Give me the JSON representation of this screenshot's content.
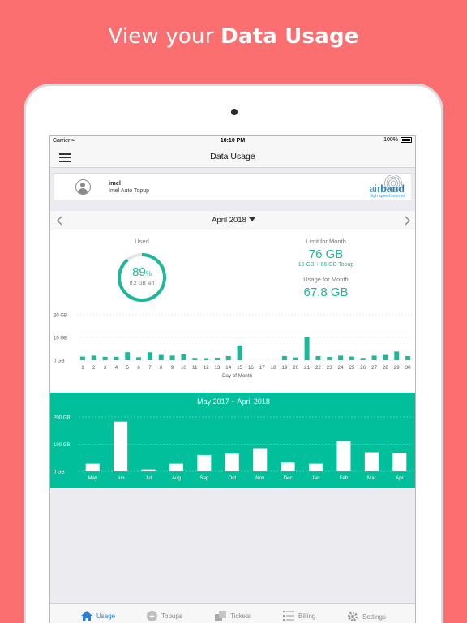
{
  "headline": {
    "prefix": "View your ",
    "bold": "Data Usage"
  },
  "status": {
    "carrier": "Carrier",
    "time": "10:10 PM",
    "battery": "100%"
  },
  "nav": {
    "title": "Data Usage"
  },
  "account": {
    "name": "imel",
    "plan": "Imel Auto Topup",
    "brand_air": "air",
    "brand_band": "band",
    "brand_sub": "high speed internet"
  },
  "month_nav": {
    "month": "April 2018"
  },
  "summary": {
    "used_label": "Used",
    "used_pct": 89,
    "pct_symbol": "%",
    "left_text": "8.2 GB left",
    "limit_label": "Limit for Month",
    "limit_value": "76 GB",
    "limit_detail": "10 GB + 66 GB Topup",
    "usage_label": "Usage for Month",
    "usage_value": "67.8 GB"
  },
  "colors": {
    "accent": "#1db79a",
    "panel": "#00bf9a",
    "background": "#fc6f71",
    "active_tab": "#2a7fd4"
  },
  "chart_data": [
    {
      "type": "bar",
      "title": "",
      "xlabel": "Day of Month",
      "ylabel": "",
      "ylim": [
        0,
        20
      ],
      "y_ticks": [
        "0 GB",
        "10 GB",
        "20 GB"
      ],
      "grid": true,
      "categories": [
        "1",
        "2",
        "3",
        "4",
        "5",
        "6",
        "7",
        "8",
        "9",
        "10",
        "11",
        "12",
        "13",
        "14",
        "15",
        "16",
        "17",
        "18",
        "19",
        "20",
        "21",
        "22",
        "23",
        "24",
        "25",
        "26",
        "27",
        "28",
        "29",
        "30"
      ],
      "values": [
        1.6,
        2.0,
        1.5,
        1.5,
        3.5,
        1.3,
        3.5,
        2.3,
        2.0,
        2.6,
        1.0,
        0.9,
        1.1,
        1.8,
        6.5,
        0,
        0,
        0,
        1.8,
        1.2,
        10.0,
        1.8,
        1.4,
        2.0,
        1.6,
        1.0,
        2.0,
        2.3,
        3.8,
        1.8
      ]
    },
    {
      "type": "bar",
      "title": "May 2017 ~ April 2018",
      "xlabel": "",
      "ylabel": "",
      "ylim": [
        0,
        200
      ],
      "y_ticks": [
        "0 GB",
        "100 GB",
        "200 GB"
      ],
      "grid": true,
      "categories": [
        "May",
        "Jun",
        "Jul",
        "Aug",
        "Sep",
        "Oct",
        "Nov",
        "Dec",
        "Jan",
        "Feb",
        "Mar",
        "Apr"
      ],
      "values": [
        28,
        183,
        7,
        28,
        60,
        65,
        85,
        32,
        28,
        110,
        70,
        67.8
      ]
    }
  ],
  "tabs": [
    {
      "label": "Usage",
      "icon": "home-icon",
      "active": true
    },
    {
      "label": "Topups",
      "icon": "plus-circle-icon",
      "active": false
    },
    {
      "label": "Tickets",
      "icon": "tickets-icon",
      "active": false
    },
    {
      "label": "Billing",
      "icon": "list-icon",
      "active": false
    },
    {
      "label": "Settings",
      "icon": "gear-icon",
      "active": false
    }
  ]
}
